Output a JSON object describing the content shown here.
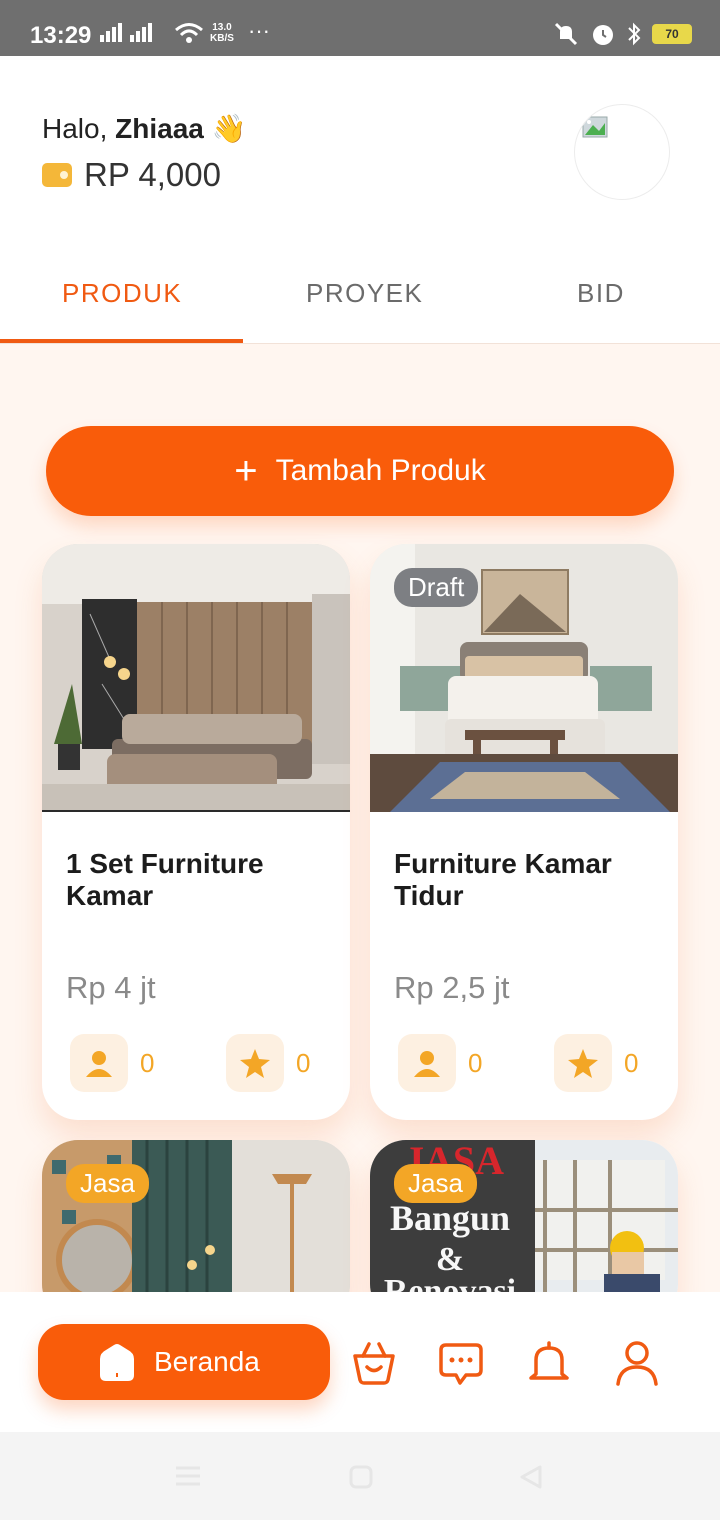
{
  "status_bar": {
    "time": "13:29",
    "speed_value": "13.0",
    "speed_unit": "KB/S",
    "battery": "70"
  },
  "header": {
    "greeting": "Halo, ",
    "user_name": "Zhiaaa",
    "wave_emoji": "👋",
    "balance": "RP 4,000"
  },
  "tabs": [
    {
      "label": "PRODUK",
      "active": true
    },
    {
      "label": "PROYEK",
      "active": false
    },
    {
      "label": "BID",
      "active": false
    }
  ],
  "add_button": {
    "label": "Tambah Produk"
  },
  "products": [
    {
      "title": "1 Set Furniture Kamar",
      "price": "Rp 4 jt",
      "badge": "",
      "users": "0",
      "favorites": "0"
    },
    {
      "title": "Furniture Kamar Tidur",
      "price": "Rp 2,5 jt",
      "badge": "Draft",
      "users": "0",
      "favorites": "0"
    },
    {
      "title": "",
      "price": "",
      "badge": "Jasa",
      "users": "",
      "favorites": ""
    },
    {
      "title": "",
      "price": "",
      "badge": "Jasa",
      "image_text_1": "JASA",
      "image_text_2": "Bangun",
      "image_text_3": "&",
      "image_text_4": "Renovasi"
    }
  ],
  "bottom_nav": {
    "home_label": "Beranda",
    "icons": [
      "basket-icon",
      "chat-icon",
      "bell-icon",
      "profile-icon"
    ]
  },
  "colors": {
    "accent": "#f95c0a",
    "badge_jasa": "#f3a626",
    "badge_draft": "#7d7f83",
    "background": "#fff6f0"
  }
}
